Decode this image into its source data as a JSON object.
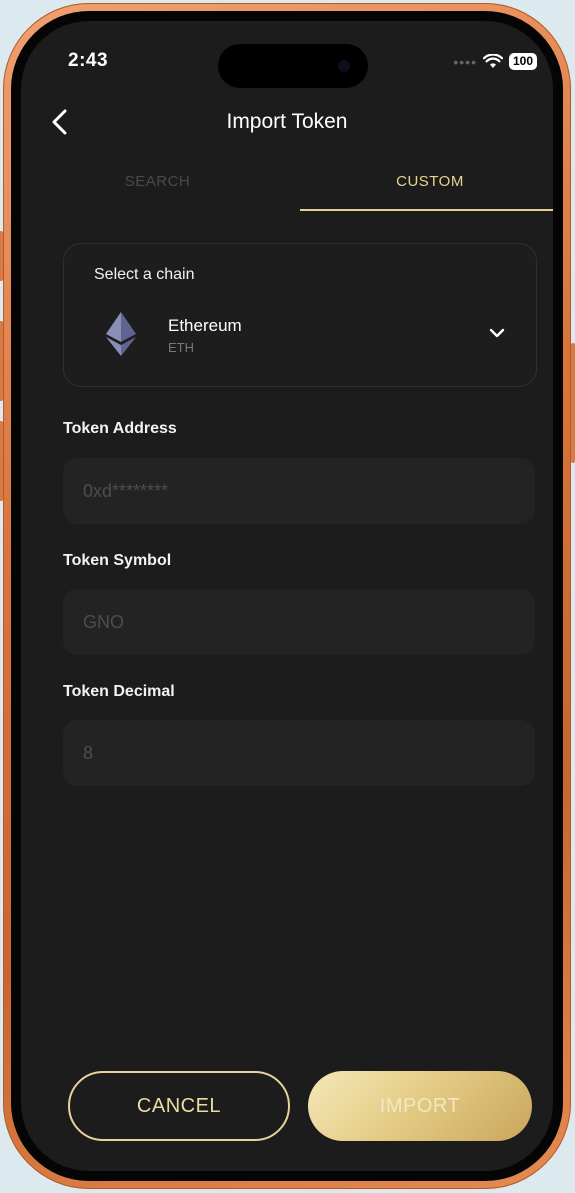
{
  "status_bar": {
    "time": "2:43",
    "battery": "100"
  },
  "header": {
    "title": "Import Token"
  },
  "tabs": [
    {
      "label": "SEARCH",
      "active": false
    },
    {
      "label": "CUSTOM",
      "active": true
    }
  ],
  "chain": {
    "label": "Select a chain",
    "name": "Ethereum",
    "symbol": "ETH",
    "icon": "ethereum-icon"
  },
  "fields": {
    "address": {
      "label": "Token Address",
      "placeholder": "0xd********"
    },
    "symbol": {
      "label": "Token Symbol",
      "placeholder": "GNO"
    },
    "decimal": {
      "label": "Token Decimal",
      "placeholder": "8"
    }
  },
  "actions": {
    "cancel": "CANCEL",
    "import": "IMPORT"
  },
  "colors": {
    "accent": "#e5cf92",
    "background": "#1c1c1c",
    "frame": "#d8743c"
  }
}
